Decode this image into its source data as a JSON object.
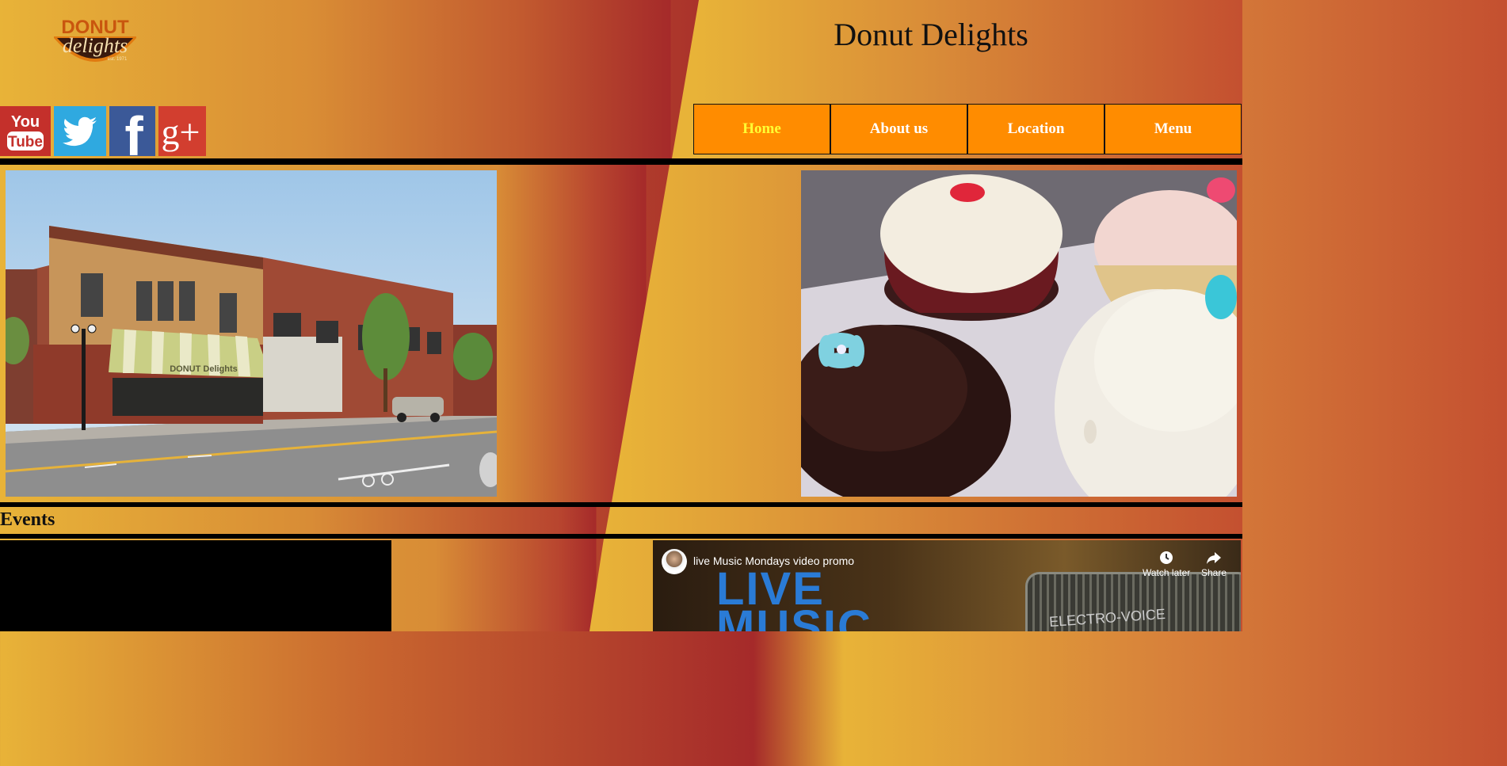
{
  "site": {
    "title": "Donut Delights",
    "logo": {
      "line1": "DONUT",
      "line2": "delights",
      "line3": "est. 1971"
    }
  },
  "social": [
    {
      "name": "youtube",
      "label_top": "You",
      "label_bottom": "Tube"
    },
    {
      "name": "twitter"
    },
    {
      "name": "facebook",
      "label": "f"
    },
    {
      "name": "google-plus",
      "label": "g+"
    }
  ],
  "nav": {
    "items": [
      "Home",
      "About us",
      "Location",
      "Menu"
    ],
    "active": "Home"
  },
  "photos": {
    "storefront_awning_text": "DONUT Delights"
  },
  "events": {
    "heading": "Events"
  },
  "video": {
    "title": "live Music Mondays video promo",
    "watch_later": "Watch later",
    "share": "Share",
    "frame_text": "LIVE\nMUSIC",
    "mic_brand": "ELECTRO-VOICE"
  },
  "colors": {
    "nav_bg": "#ff8c00",
    "nav_active_text": "#ffff33",
    "nav_text": "#ffffff",
    "accent_red": "#a52a2a",
    "accent_gold": "#e8b338"
  }
}
